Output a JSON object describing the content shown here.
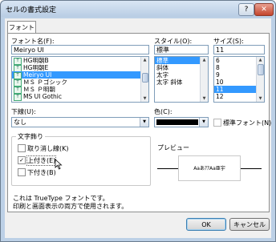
{
  "window": {
    "title": "セルの書式設定",
    "help": "?",
    "close": "✕"
  },
  "tab": {
    "label": "フォント"
  },
  "font": {
    "label": "フォント名(F):",
    "value": "Meiryo UI",
    "items": [
      {
        "label": "HG明朝B",
        "selected": false
      },
      {
        "label": "HG明朝E",
        "selected": false
      },
      {
        "label": "Meiryo UI",
        "selected": true
      },
      {
        "label": "ＭＳ Ｐゴシック",
        "selected": false
      },
      {
        "label": "ＭＳ Ｐ明朝",
        "selected": false
      },
      {
        "label": "MS UI Gothic",
        "selected": false
      }
    ]
  },
  "style": {
    "label": "スタイル(O):",
    "value": "標準",
    "items": [
      {
        "label": "標準",
        "selected": true
      },
      {
        "label": "斜体",
        "selected": false
      },
      {
        "label": "太字",
        "selected": false
      },
      {
        "label": "太字 斜体",
        "selected": false
      }
    ]
  },
  "size": {
    "label": "サイズ(S):",
    "value": "11",
    "items": [
      {
        "label": "6",
        "selected": false
      },
      {
        "label": "8",
        "selected": false
      },
      {
        "label": "9",
        "selected": false
      },
      {
        "label": "10",
        "selected": false
      },
      {
        "label": "11",
        "selected": true
      },
      {
        "label": "12",
        "selected": false
      }
    ]
  },
  "underline": {
    "label": "下線(U):",
    "value": "なし"
  },
  "color": {
    "label": "色(C):",
    "swatch": "#000000",
    "normal_font_label": "標準フォント(N)"
  },
  "effects": {
    "title": "文字飾り",
    "items": [
      {
        "label": "取り消し線(K)",
        "checked": false
      },
      {
        "label": "上付き(E)",
        "checked": true
      },
      {
        "label": "下付き(B)",
        "checked": false
      }
    ]
  },
  "preview": {
    "title": "プレビュー",
    "sample": "AaあｱｱAa亜宇"
  },
  "info": {
    "line1": "これは TrueType フォントです。",
    "line2": "印刷と画面表示の両方で使用されます。"
  },
  "buttons": {
    "ok": "OK",
    "cancel": "キャンセル"
  }
}
